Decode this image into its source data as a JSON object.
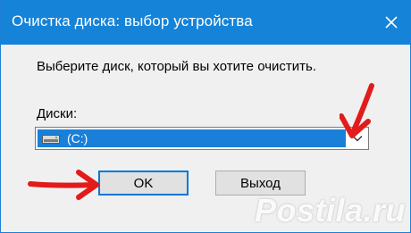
{
  "window": {
    "title": "Очистка диска: выбор устройства",
    "close_icon": "close-icon"
  },
  "dialog": {
    "prompt": "Выберите диск, который вы хотите очистить.",
    "drives_label": "Диски:",
    "drive_select": {
      "selected": "(C:)",
      "icon": "hard-drive-icon"
    },
    "ok_label": "OK",
    "exit_label": "Выход"
  },
  "overlay": {
    "watermark": "Postila.ru",
    "arrow_color": "#e21b1b"
  },
  "colors": {
    "titlebar": "#1583d8",
    "selection": "#1a7fd9",
    "dialog_bg": "#f0f0f0"
  }
}
